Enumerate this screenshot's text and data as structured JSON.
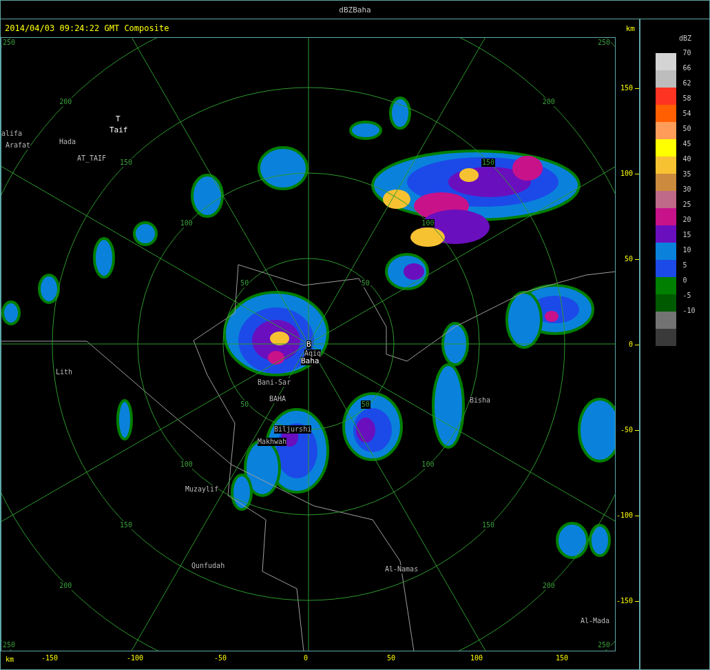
{
  "window": {
    "title": "dBZBaha"
  },
  "header": {
    "timestamp": "2014/04/03 09:24:22 GMT Composite",
    "unit": "km"
  },
  "range_rings": [
    {
      "labels": [
        "50",
        "50",
        "50",
        "50"
      ]
    },
    {
      "labels": [
        "100",
        "100",
        "100",
        "100"
      ]
    },
    {
      "labels": [
        "150",
        "150",
        "150",
        "150"
      ]
    },
    {
      "labels": [
        "200",
        "200",
        "200",
        "200"
      ]
    },
    {
      "labels": [
        "250",
        "250",
        "250",
        "250"
      ]
    }
  ],
  "places": [
    {
      "name": "T",
      "kind": "marker"
    },
    {
      "name": "Taif",
      "kind": "station"
    },
    {
      "name": "alifa",
      "kind": "town"
    },
    {
      "name": "Arafat",
      "kind": "town"
    },
    {
      "name": "Hada",
      "kind": "town"
    },
    {
      "name": "AT_TAIF",
      "kind": "town"
    },
    {
      "name": "Lith",
      "kind": "town"
    },
    {
      "name": "B",
      "kind": "marker"
    },
    {
      "name": "Aqiq",
      "kind": "town"
    },
    {
      "name": "Baha",
      "kind": "station"
    },
    {
      "name": "Bani-Sar",
      "kind": "town"
    },
    {
      "name": "BAHA",
      "kind": "town"
    },
    {
      "name": "Biljurshi",
      "kind": "town"
    },
    {
      "name": "Makhwah",
      "kind": "town"
    },
    {
      "name": "Bisha",
      "kind": "town"
    },
    {
      "name": "Muzaylif",
      "kind": "town"
    },
    {
      "name": "Qunfudah",
      "kind": "town"
    },
    {
      "name": "Al-Namas",
      "kind": "town"
    },
    {
      "name": "Al-Mada",
      "kind": "town"
    }
  ],
  "y_axis": {
    "ticks": [
      "150",
      "100",
      "50",
      "0",
      "-50",
      "-100",
      "-150"
    ]
  },
  "x_axis": {
    "unit": "km",
    "ticks": [
      "-150",
      "-100",
      "-50",
      "0",
      "50",
      "100",
      "150"
    ]
  },
  "legend": {
    "title": "dBZ",
    "labels": [
      "70",
      "66",
      "62",
      "58",
      "54",
      "50",
      "45",
      "40",
      "35",
      "30",
      "25",
      "20",
      "15",
      "10",
      "5",
      "0",
      "-5",
      "-10"
    ],
    "swatches": [
      {
        "color": "#d4d4d4"
      },
      {
        "color": "#bdbdbd"
      },
      {
        "color": "#ff3322"
      },
      {
        "color": "#ff5f00"
      },
      {
        "color": "#ff9c5a"
      },
      {
        "color": "#ffff00"
      },
      {
        "color": "#f7c232"
      },
      {
        "color": "#cc8a3e"
      },
      {
        "color": "#bf6a88"
      },
      {
        "color": "#c8128a"
      },
      {
        "color": "#6a0fbe"
      },
      {
        "color": "#0a82dc"
      },
      {
        "color": "#1c4ae8"
      },
      {
        "color": "#007f00"
      },
      {
        "color": "#005a00"
      },
      {
        "color": "#737373"
      },
      {
        "color": "#3a3a3a"
      }
    ]
  }
}
